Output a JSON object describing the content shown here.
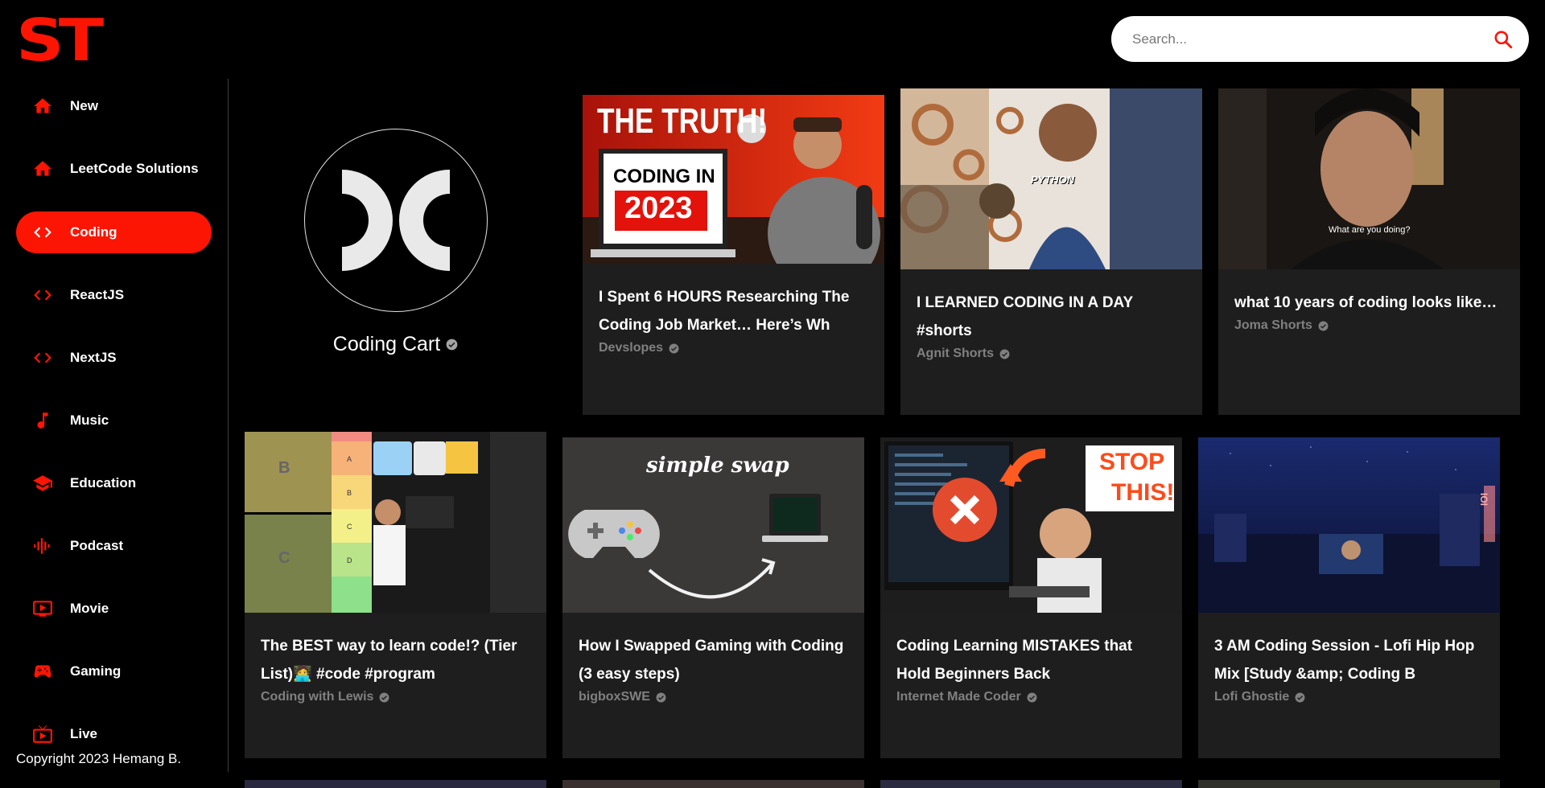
{
  "header": {
    "logo_text": "ST",
    "search_placeholder": "Search...",
    "accent_color": "#fc1503"
  },
  "sidebar": {
    "items": [
      {
        "label": "New",
        "icon": "home-icon"
      },
      {
        "label": "LeetCode Solutions",
        "icon": "home-icon"
      },
      {
        "label": "Coding",
        "icon": "code-icon",
        "active": true
      },
      {
        "label": "ReactJS",
        "icon": "code-icon"
      },
      {
        "label": "NextJS",
        "icon": "code-icon"
      },
      {
        "label": "Music",
        "icon": "music-note-icon"
      },
      {
        "label": "Education",
        "icon": "graduation-cap-icon"
      },
      {
        "label": "Podcast",
        "icon": "podcast-icon"
      },
      {
        "label": "Movie",
        "icon": "ondemand-video-icon"
      },
      {
        "label": "Gaming",
        "icon": "gamepad-icon"
      },
      {
        "label": "Live",
        "icon": "live-tv-icon"
      }
    ],
    "copyright": "Copyright 2023 Hemang B."
  },
  "channel": {
    "name": "Coding Cart"
  },
  "videos": [
    {
      "title": "I Spent 6 HOURS Researching The Coding Job Market… Here’s Wh",
      "channel": "Devslopes",
      "thumb_text": [
        "THE TRUTH!",
        "CODING IN",
        "2023"
      ]
    },
    {
      "title": "I LEARNED CODING IN A DAY #shorts",
      "channel": "Agnit Shorts",
      "thumb_text": [
        "PYTHON"
      ]
    },
    {
      "title": "what 10 years of coding looks like…",
      "channel": "Joma Shorts",
      "thumb_text": [
        "What are you doing?"
      ]
    },
    {
      "title": "The BEST way to learn code!? (Tier List)🧑‍💻 #code #program",
      "channel": "Coding with Lewis",
      "thumb_text": [
        "B",
        "C",
        "A",
        "B",
        "C",
        "D"
      ]
    },
    {
      "title": "How I Swapped Gaming with Coding (3 easy steps)",
      "channel": "bigboxSWE",
      "thumb_text": [
        "simple swap"
      ]
    },
    {
      "title": "Coding Learning MISTAKES that Hold Beginners Back",
      "channel": "Internet Made Coder",
      "thumb_text": [
        "STOP",
        "THIS!"
      ]
    },
    {
      "title": "3 AM Coding Session - Lofi Hip Hop Mix [Study &amp; Coding B",
      "channel": "Lofi Ghostie",
      "thumb_text": [
        "IOI"
      ]
    }
  ]
}
